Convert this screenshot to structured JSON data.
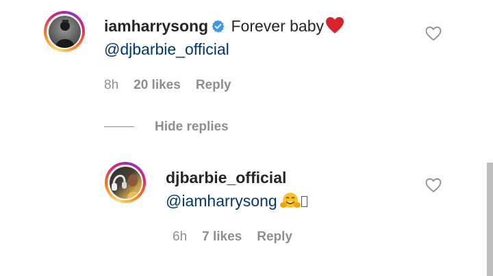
{
  "comments": [
    {
      "username": "iamharrysong",
      "verified": true,
      "text": "Forever baby",
      "emoji": "heart",
      "mention": "@dj​barbie_official",
      "time": "8h",
      "likes": "20 likes",
      "reply_label": "Reply"
    },
    {
      "username": "djbarbie_official",
      "mention": "@iamharrysong",
      "emoji": "hugging-face",
      "time": "6h",
      "likes": "7 likes",
      "reply_label": "Reply"
    }
  ],
  "thread": {
    "hide_replies_label": "Hide replies"
  },
  "colors": {
    "text": "#262626",
    "mention": "#00376b",
    "meta": "#8e8e8e",
    "verified": "#3897f0",
    "heart": "#ed4956"
  }
}
